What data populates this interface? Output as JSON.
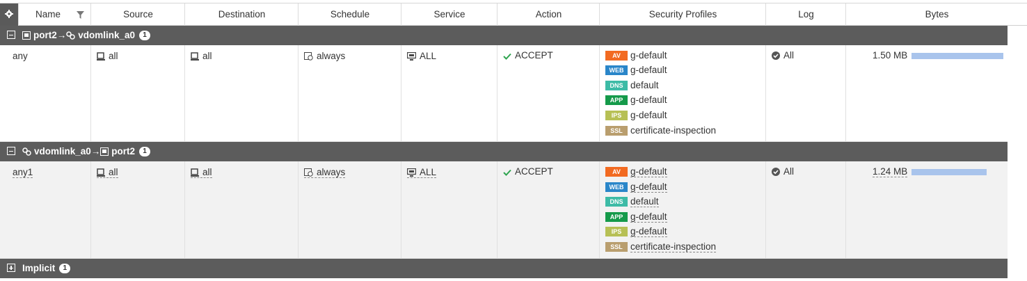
{
  "columns": [
    "Name",
    "Source",
    "Destination",
    "Schedule",
    "Service",
    "Action",
    "Security Profiles",
    "Log",
    "Bytes"
  ],
  "groups": [
    {
      "title_from": "port2",
      "title_to": "vdomlink_a0",
      "count": "1",
      "rows": [
        {
          "name": "any",
          "source": "all",
          "destination": "all",
          "schedule": "always",
          "service": "ALL",
          "action": "ACCEPT",
          "profiles": [
            {
              "badge": "AV",
              "text": "g-default",
              "color": "#f26a21"
            },
            {
              "badge": "WEB",
              "text": "g-default",
              "color": "#2a86c9"
            },
            {
              "badge": "DNS",
              "text": "default",
              "color": "#3dbba6"
            },
            {
              "badge": "APP",
              "text": "g-default",
              "color": "#159a4a"
            },
            {
              "badge": "IPS",
              "text": "g-default",
              "color": "#b7c055"
            },
            {
              "badge": "SSL",
              "text": "certificate-inspection",
              "color": "#b99e6e"
            }
          ],
          "log": "All",
          "bytes": "1.50 MB",
          "bytes_fraction": 1.0
        }
      ]
    },
    {
      "title_from": "vdomlink_a0",
      "title_to": "port2",
      "count": "1",
      "rows": [
        {
          "name": "any1",
          "source": "all",
          "destination": "all",
          "schedule": "always",
          "service": "ALL",
          "action": "ACCEPT",
          "profiles": [
            {
              "badge": "AV",
              "text": "g-default",
              "color": "#f26a21"
            },
            {
              "badge": "WEB",
              "text": "g-default",
              "color": "#2a86c9"
            },
            {
              "badge": "DNS",
              "text": "default",
              "color": "#3dbba6"
            },
            {
              "badge": "APP",
              "text": "g-default",
              "color": "#159a4a"
            },
            {
              "badge": "IPS",
              "text": "g-default",
              "color": "#b7c055"
            },
            {
              "badge": "SSL",
              "text": "certificate-inspection",
              "color": "#b99e6e"
            }
          ],
          "log": "All",
          "bytes": "1.24 MB",
          "bytes_fraction": 0.82
        }
      ]
    },
    {
      "title": "Implicit",
      "count": "1"
    }
  ],
  "colors": {
    "group_bg": "#5c5c5c",
    "accept_green": "#2ea44f",
    "bytes_bar": "#a9c4ec"
  }
}
